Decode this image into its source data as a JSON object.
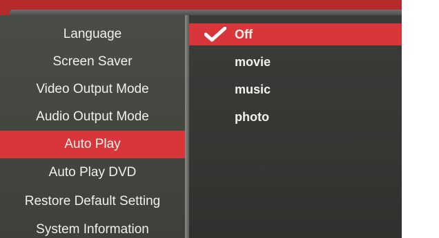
{
  "menu": {
    "items": [
      {
        "label": "Language"
      },
      {
        "label": "Screen Saver"
      },
      {
        "label": "Video Output Mode"
      },
      {
        "label": "Audio Output Mode"
      },
      {
        "label": "Auto Play"
      },
      {
        "label": "Auto Play DVD"
      },
      {
        "label": "Restore Default Setting"
      },
      {
        "label": "System Information"
      }
    ],
    "selected": "Auto Play"
  },
  "options": {
    "items": [
      {
        "label": "Off",
        "checked": true
      },
      {
        "label": "movie"
      },
      {
        "label": "music"
      },
      {
        "label": "photo"
      }
    ],
    "selected": "Off"
  },
  "colors": {
    "highlight": "#d9363c",
    "frame": "#b52a2a"
  },
  "icons": {
    "selected_mark": "checkmark-icon"
  }
}
